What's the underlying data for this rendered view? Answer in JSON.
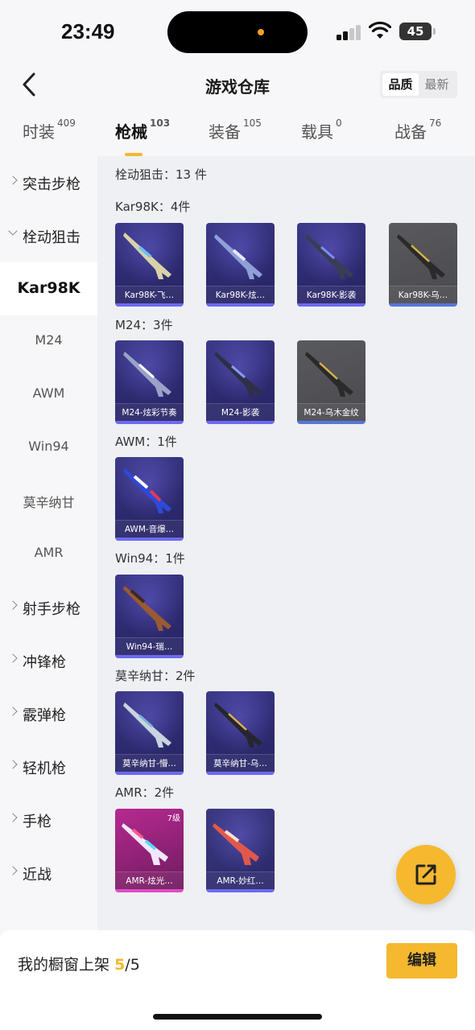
{
  "status": {
    "time": "23:49",
    "battery": "45"
  },
  "header": {
    "title": "游戏仓库",
    "sort_options": [
      "品质",
      "最新"
    ],
    "sort_selected": "品质"
  },
  "tabs": [
    {
      "label": "时装",
      "count": "409"
    },
    {
      "label": "枪械",
      "count": "103"
    },
    {
      "label": "装备",
      "count": "105"
    },
    {
      "label": "载具",
      "count": "0"
    },
    {
      "label": "战备",
      "count": "76"
    }
  ],
  "sidebar": {
    "items": [
      {
        "label": "突击步枪"
      },
      {
        "label": "栓动狙击"
      },
      {
        "label": "Kar98K"
      },
      {
        "label": "M24"
      },
      {
        "label": "AWM"
      },
      {
        "label": "Win94"
      },
      {
        "label": "莫辛纳甘"
      },
      {
        "label": "AMR"
      },
      {
        "label": "射手步枪"
      },
      {
        "label": "冲锋枪"
      },
      {
        "label": "霰弹枪"
      },
      {
        "label": "轻机枪"
      },
      {
        "label": "手枪"
      },
      {
        "label": "近战"
      }
    ]
  },
  "content": {
    "category_summary": "栓动狙击：13 件",
    "groups": [
      {
        "title": "Kar98K：4件",
        "items": [
          {
            "caption": "Kar98K-飞…"
          },
          {
            "caption": "Kar98K-炫…"
          },
          {
            "caption": "Kar98K-影袭"
          },
          {
            "caption": "Kar98K-乌…"
          }
        ]
      },
      {
        "title": "M24：3件",
        "items": [
          {
            "caption": "M24-炫彩节奏"
          },
          {
            "caption": "M24-影袭"
          },
          {
            "caption": "M24-乌木金纹"
          }
        ]
      },
      {
        "title": "AWM：1件",
        "items": [
          {
            "caption": "AWM-音爆…"
          }
        ]
      },
      {
        "title": "Win94：1件",
        "items": [
          {
            "caption": "Win94-瑞…"
          }
        ]
      },
      {
        "title": "莫辛纳甘：2件",
        "items": [
          {
            "caption": "莫辛纳甘-懵…"
          },
          {
            "caption": "莫辛纳甘-乌…"
          }
        ]
      },
      {
        "title": "AMR：2件",
        "items": [
          {
            "caption": "AMR-炫光…",
            "level": "7级"
          },
          {
            "caption": "AMR-妙红…"
          }
        ]
      }
    ]
  },
  "bottom": {
    "label": "我的橱窗上架",
    "shown": "5",
    "total": "/5",
    "edit": "编辑"
  },
  "colors": {
    "accent": "#f5b82e",
    "card_bg": "#2d2a6f",
    "card_border": "#6c6af0"
  }
}
